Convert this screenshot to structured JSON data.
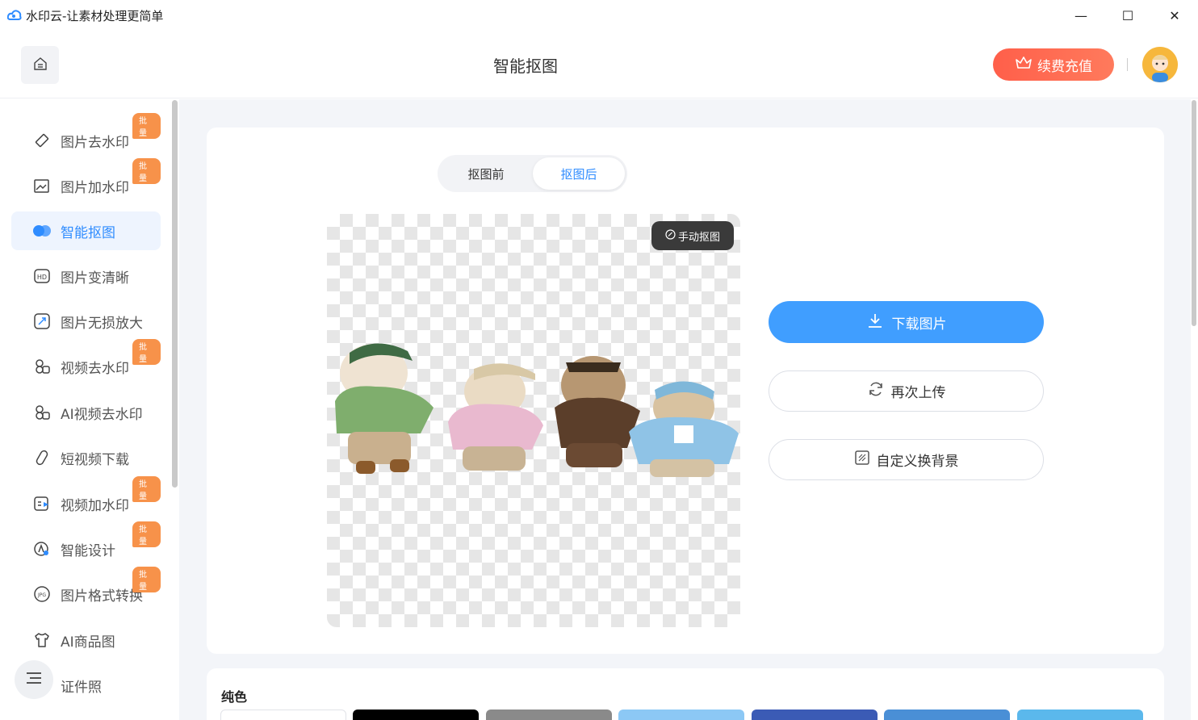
{
  "window": {
    "title": "水印云-让素材处理更简单",
    "controls": {
      "minimize": "—",
      "maximize": "☐",
      "close": "✕"
    }
  },
  "header": {
    "title": "智能抠图",
    "renew_label": "续费充值"
  },
  "sidebar": {
    "items": [
      {
        "label": "图片去水印",
        "icon": "eraser-icon",
        "badge": "批量"
      },
      {
        "label": "图片加水印",
        "icon": "image-add-icon",
        "badge": "批量"
      },
      {
        "label": "智能抠图",
        "icon": "cutout-icon",
        "badge": "",
        "active": true
      },
      {
        "label": "图片变清晰",
        "icon": "hd-icon",
        "badge": ""
      },
      {
        "label": "图片无损放大",
        "icon": "enlarge-icon",
        "badge": ""
      },
      {
        "label": "视频去水印",
        "icon": "video-eraser-icon",
        "badge": "批量"
      },
      {
        "label": "AI视频去水印",
        "icon": "ai-video-icon",
        "badge": ""
      },
      {
        "label": "短视频下载",
        "icon": "download-link-icon",
        "badge": ""
      },
      {
        "label": "视频加水印",
        "icon": "video-add-icon",
        "badge": "批量"
      },
      {
        "label": "智能设计",
        "icon": "design-icon",
        "badge": "批量"
      },
      {
        "label": "图片格式转换",
        "icon": "jpg-icon",
        "badge": "批量"
      },
      {
        "label": "AI商品图",
        "icon": "tshirt-icon",
        "badge": ""
      },
      {
        "label": "证件照",
        "icon": "id-photo-icon",
        "badge": ""
      }
    ]
  },
  "main": {
    "tabs": [
      {
        "label": "抠图前",
        "active": false
      },
      {
        "label": "抠图后",
        "active": true
      }
    ],
    "manual_label": "手动抠图",
    "download_label": "下载图片",
    "reupload_label": "再次上传",
    "custom_bg_label": "自定义换背景",
    "solid_color_label": "纯色",
    "swatches": [
      "#ffffff",
      "#000000",
      "#8a8a8a",
      "#8cc8f5",
      "#3b5bb5",
      "#4a8fd6",
      "#5bb8ec"
    ]
  },
  "colors": {
    "accent": "#409eff",
    "renew": "#ff6450",
    "badge": "#f7924a"
  }
}
